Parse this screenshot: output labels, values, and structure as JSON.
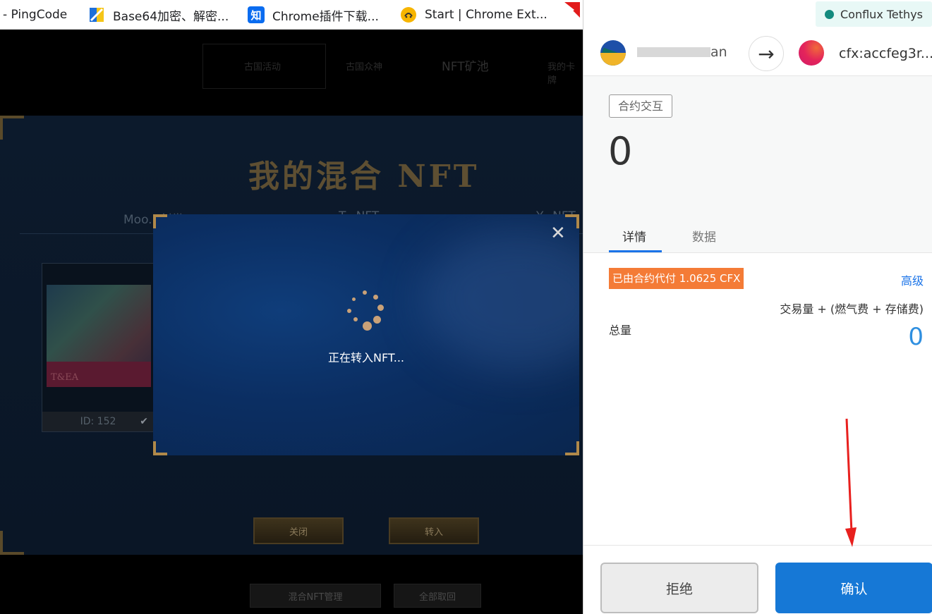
{
  "bookmarks": [
    {
      "label": "- PingCode",
      "icon": "none"
    },
    {
      "label": "Base64加密、解密...",
      "icon": "base64-icon"
    },
    {
      "label": "Chrome插件下载...",
      "icon": "zhi-icon",
      "icon_text": "知"
    },
    {
      "label": "Start | Chrome Ext...",
      "icon": "smiley-icon"
    }
  ],
  "game": {
    "nav": [
      "古国活动",
      "古国众神",
      "NFT矿池",
      "我的卡牌"
    ],
    "title": "我的混合 NFT",
    "tabs": [
      "Moo...创世NFT",
      "T...NFT",
      "Y...NFT"
    ],
    "card": {
      "image_text": "T&EA",
      "id": "ID: 152"
    },
    "buttons": {
      "close": "关闭",
      "transfer": "转入",
      "manage": "混合NFT管理",
      "recall_all": "全部取回"
    }
  },
  "modal": {
    "close_symbol": "✕",
    "status": "正在转入NFT..."
  },
  "wallet": {
    "network": "Conflux Tethys",
    "account_suffix": "an",
    "arrow_symbol": "→",
    "to_address": "cfx:accfeg3r...",
    "badge": "合约交互",
    "amount": "0",
    "tabs": [
      "详情",
      "数据"
    ],
    "sponsor": "已由合约代付 1.0625 CFX",
    "advanced": "高级",
    "formula": "交易量 + (燃气费 + 存储费)",
    "total_label": "总量",
    "total_value": "0",
    "reject": "拒绝",
    "confirm": "确认"
  },
  "colors": {
    "confirm": "#1678d6",
    "sponsor": "#f47b36",
    "network_dot": "#138a7e",
    "total_value": "#2f8fe0",
    "annotation": "#e8201e"
  }
}
